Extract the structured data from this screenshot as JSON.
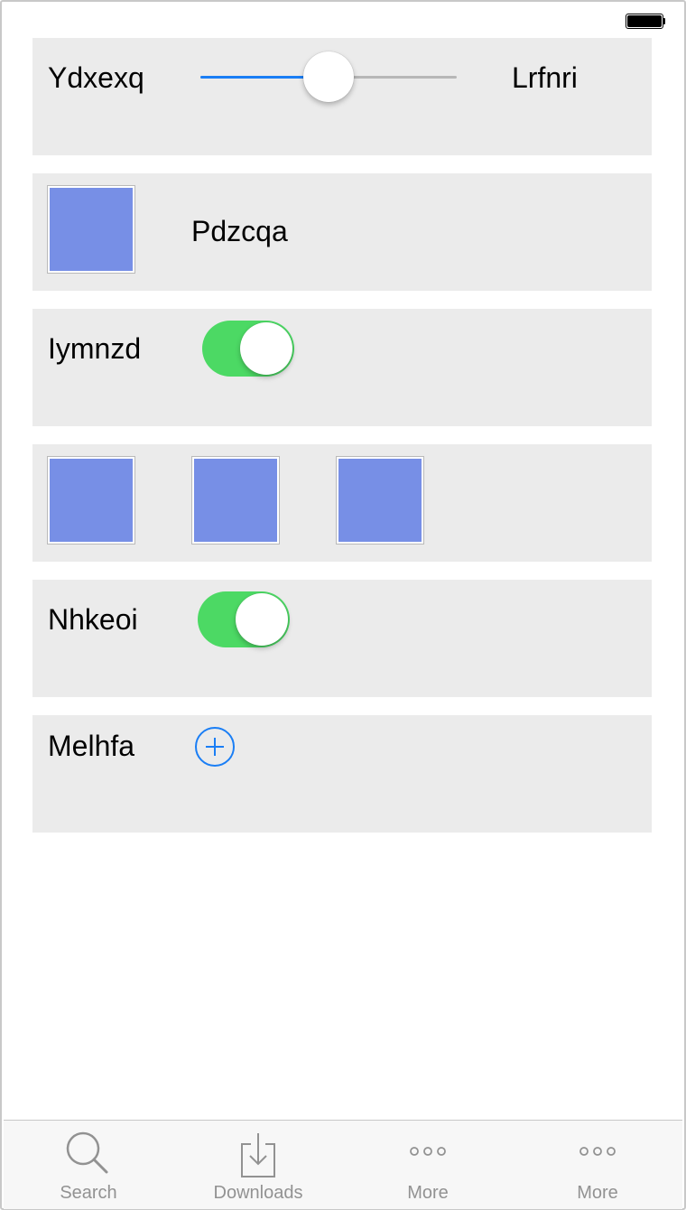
{
  "rows": {
    "slider_row": {
      "left_label": "Ydxexq",
      "right_label": "Lrfnri",
      "slider_value_fraction": 0.5
    },
    "image_row": {
      "label": "Pdzcqa"
    },
    "toggle_row_1": {
      "label": "Iymnzd",
      "on": true
    },
    "toggle_row_2": {
      "label": "Nhkeoi",
      "on": true
    },
    "add_row": {
      "label": "Melhfa"
    }
  },
  "tabbar": {
    "items": [
      {
        "label": "Search",
        "icon": "search-icon"
      },
      {
        "label": "Downloads",
        "icon": "download-icon"
      },
      {
        "label": "More",
        "icon": "more-icon"
      },
      {
        "label": "More",
        "icon": "more-icon"
      }
    ]
  },
  "colors": {
    "accent": "#1a7ef5",
    "toggle_on": "#4cd964",
    "card_bg": "#ebebeb",
    "image_placeholder": "#778fe6",
    "tab_label": "#929292"
  }
}
